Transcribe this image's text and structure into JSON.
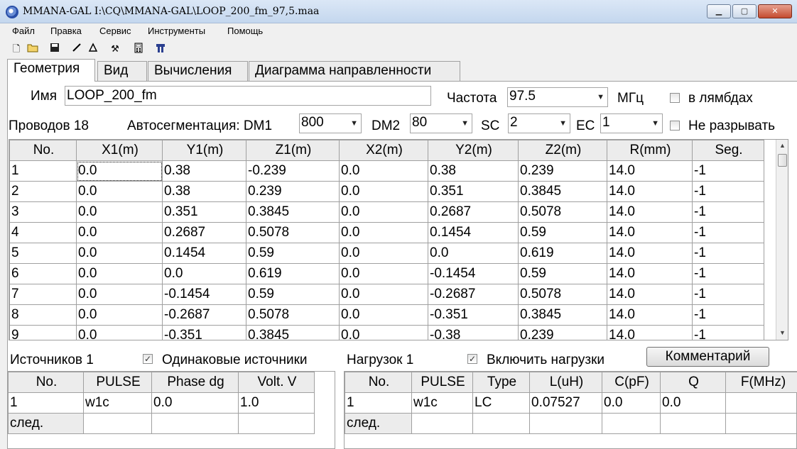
{
  "window": {
    "title": "MMANA-GAL I:\\CQ\\MMANA-GAL\\LOOP_200_fm_97,5.maa"
  },
  "menu": [
    "Файл",
    "Правка",
    "Сервис",
    "Инструменты",
    "Помощь"
  ],
  "tabs": [
    "Геометрия",
    "Вид",
    "Вычисления",
    "Диаграмма направленности"
  ],
  "geometry": {
    "name_label": "Имя",
    "name_value": "LOOP_200_fm",
    "freq_label": "Частота",
    "freq_value": "97.5",
    "freq_unit": "МГц",
    "lambda_label": "в лямбдах",
    "wires_label": "Проводов 18",
    "autoseg_label": "Автосегментация: DM1",
    "dm1": "800",
    "dm2_label": "DM2",
    "dm2": "80",
    "sc_label": "SC",
    "sc": "2",
    "ec_label": "EC",
    "ec": "1",
    "nobreak_label": "Не разрывать"
  },
  "wires": {
    "headers": [
      "No.",
      "X1(m)",
      "Y1(m)",
      "Z1(m)",
      "X2(m)",
      "Y2(m)",
      "Z2(m)",
      "R(mm)",
      "Seg."
    ],
    "rows": [
      [
        "1",
        "0.0",
        "0.38",
        "-0.239",
        "0.0",
        "0.38",
        "0.239",
        "14.0",
        "-1"
      ],
      [
        "2",
        "0.0",
        "0.38",
        "0.239",
        "0.0",
        "0.351",
        "0.3845",
        "14.0",
        "-1"
      ],
      [
        "3",
        "0.0",
        "0.351",
        "0.3845",
        "0.0",
        "0.2687",
        "0.5078",
        "14.0",
        "-1"
      ],
      [
        "4",
        "0.0",
        "0.2687",
        "0.5078",
        "0.0",
        "0.1454",
        "0.59",
        "14.0",
        "-1"
      ],
      [
        "5",
        "0.0",
        "0.1454",
        "0.59",
        "0.0",
        "0.0",
        "0.619",
        "14.0",
        "-1"
      ],
      [
        "6",
        "0.0",
        "0.0",
        "0.619",
        "0.0",
        "-0.1454",
        "0.59",
        "14.0",
        "-1"
      ],
      [
        "7",
        "0.0",
        "-0.1454",
        "0.59",
        "0.0",
        "-0.2687",
        "0.5078",
        "14.0",
        "-1"
      ],
      [
        "8",
        "0.0",
        "-0.2687",
        "0.5078",
        "0.0",
        "-0.351",
        "0.3845",
        "14.0",
        "-1"
      ],
      [
        "9",
        "0.0",
        "-0.351",
        "0.3845",
        "0.0",
        "-0.38",
        "0.239",
        "14.0",
        "-1"
      ]
    ]
  },
  "sources": {
    "label": "Источников 1",
    "same_label": "Одинаковые источники",
    "headers": [
      "No.",
      "PULSE",
      "Phase dg",
      "Volt. V"
    ],
    "rows": [
      [
        "1",
        "w1c",
        "0.0",
        "1.0"
      ]
    ],
    "next": "след."
  },
  "loads": {
    "label": "Нагрузок 1",
    "enable_label": "Включить нагрузки",
    "comment_button": "Комментарий",
    "headers": [
      "No.",
      "PULSE",
      "Type",
      "L(uH)",
      "C(pF)",
      "Q",
      "F(MHz)"
    ],
    "rows": [
      [
        "1",
        "w1c",
        "LC",
        "0.07527",
        "0.0",
        "0.0",
        ""
      ]
    ],
    "next": "след."
  },
  "colors": {
    "titlebar": "#c4d7ee",
    "panel": "#ffffff",
    "header": "#ececec"
  }
}
